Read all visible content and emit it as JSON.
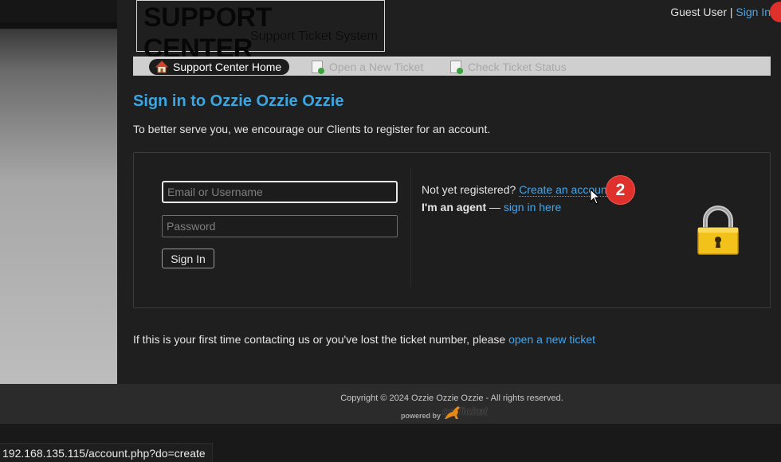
{
  "header": {
    "logo_title": "SUPPORT CENTER",
    "logo_subtitle": "Support Ticket System",
    "guest_label": "Guest User |",
    "signin_link": "Sign In"
  },
  "nav": {
    "items": [
      {
        "label": "Support Center Home",
        "icon": "house-icon",
        "active": true
      },
      {
        "label": "Open a New Ticket",
        "icon": "new-ticket-icon",
        "active": false
      },
      {
        "label": "Check Ticket Status",
        "icon": "ticket-status-icon",
        "active": false
      }
    ]
  },
  "main": {
    "title": "Sign in to Ozzie Ozzie Ozzie",
    "intro": "To better serve you, we encourage our Clients to register for an account."
  },
  "login": {
    "email_placeholder": "Email or Username",
    "password_placeholder": "Password",
    "signin_button": "Sign In"
  },
  "register": {
    "prompt": "Not yet registered?",
    "create_link": "Create an account",
    "agent_label": "I'm an agent",
    "agent_dash": "—",
    "agent_link": "sign in here"
  },
  "annotation": {
    "badge_number": "2"
  },
  "first_time": {
    "text": "If this is your first time contacting us or you've lost the ticket number, please",
    "link": "open a new ticket"
  },
  "footer": {
    "copyright": "Copyright © 2024 Ozzie Ozzie Ozzie - All rights reserved.",
    "powered_by": "powered by",
    "brand": "osTicket"
  },
  "status_bar": {
    "url": "192.168.135.115/account.php?do=create"
  },
  "colors": {
    "link": "#46a6ea",
    "title": "#3aa7e4",
    "badge": "#e0302c",
    "background": "#1f1f1f"
  }
}
